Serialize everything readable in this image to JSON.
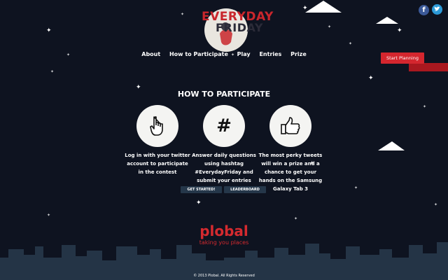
{
  "logo": {
    "line1": "EVERYDAY",
    "line2": "FRIDAY"
  },
  "nav": {
    "items": [
      "About",
      "How to Participate",
      "Play",
      "Entries",
      "Prize"
    ]
  },
  "social": {
    "facebook": "f",
    "twitter": "t"
  },
  "start_planning": "Start Planning",
  "section_title": "HOW TO PARTICIPATE",
  "steps": [
    {
      "icon": "pointing-hand-icon",
      "text": "Log in with your twitter account to participate in the contest"
    },
    {
      "icon": "hashtag-icon",
      "symbol": "#",
      "text": "Answer daily questions using hashtag #EverydayFriday and submit your entries"
    },
    {
      "icon": "thumbs-up-icon",
      "text": "The most perky tweets will win a prize and a chance to get your hands on the Samsung Galaxy Tab 3"
    }
  ],
  "buttons": {
    "get_started": "GET STARTED!",
    "leaderboard": "LEADERBOARD"
  },
  "brand": {
    "name": "plobal",
    "tagline": "taking you places"
  },
  "footer": "© 2013 Plobal. All Rights Reserved",
  "colors": {
    "background": "#0e1320",
    "accent": "#d4262e",
    "button": "#25374a",
    "city": "#243446"
  }
}
